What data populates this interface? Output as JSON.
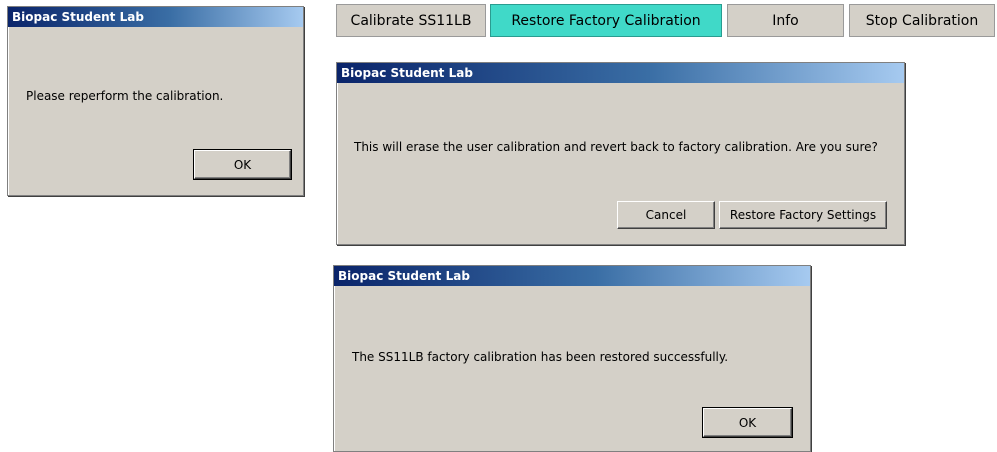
{
  "toolbar": {
    "calibrate_label": "Calibrate SS11LB",
    "restore_label": "Restore Factory Calibration",
    "info_label": "Info",
    "stop_label": "Stop Calibration",
    "active_color": "#40d9c8"
  },
  "dialog_reperform": {
    "title": "Biopac Student Lab",
    "message": "Please reperform the calibration.",
    "ok_label": "OK"
  },
  "dialog_confirm": {
    "title": "Biopac Student Lab",
    "message": "This will erase the user calibration and revert back to factory calibration. Are you sure?",
    "cancel_label": "Cancel",
    "restore_label": "Restore Factory Settings"
  },
  "dialog_success": {
    "title": "Biopac Student Lab",
    "message": "The SS11LB factory calibration has been restored successfully.",
    "ok_label": "OK"
  }
}
